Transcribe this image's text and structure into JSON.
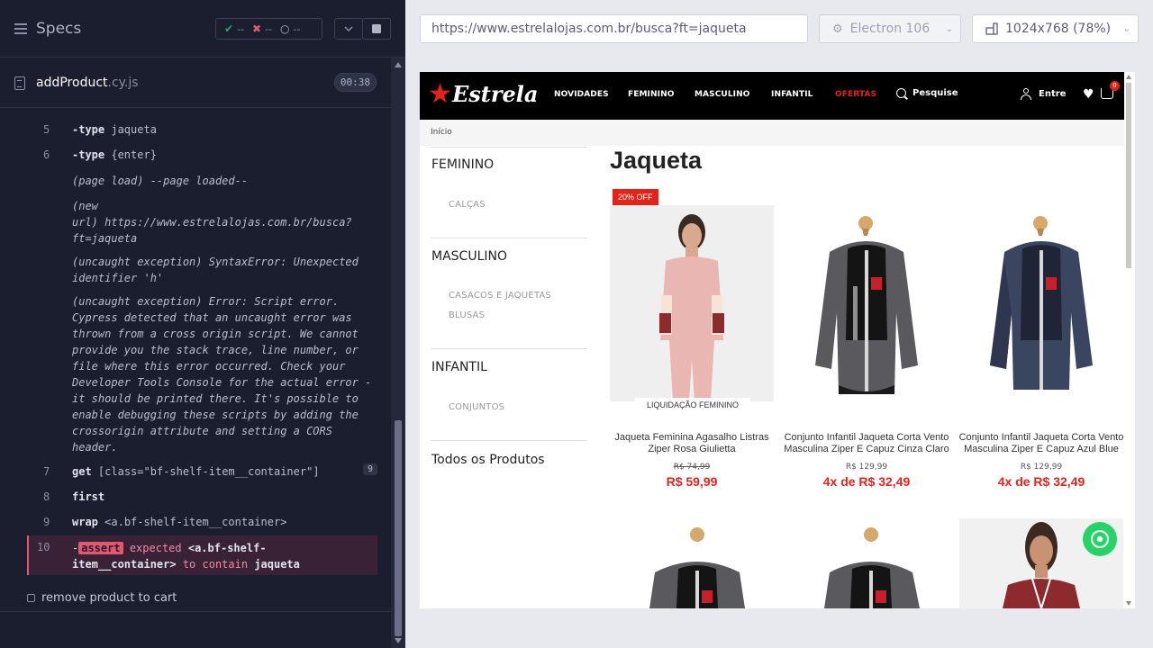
{
  "reporter": {
    "title": "Specs",
    "stats": {
      "passed": "--",
      "failed": "--",
      "pending": "--"
    },
    "spec": {
      "name": "addProduct",
      "ext": ".cy.js",
      "duration": "00:38"
    },
    "commands": [
      {
        "num": "5",
        "name": "-type",
        "arg": "jaqueta"
      },
      {
        "num": "6",
        "name": "-type",
        "arg": "{enter}"
      },
      {
        "num": "7",
        "name": "get",
        "arg": "[class=\"bf-shelf-item__container\"]",
        "count": "9"
      },
      {
        "num": "8",
        "name": "first",
        "arg": ""
      },
      {
        "num": "9",
        "name": "wrap",
        "arg": "<a.bf-shelf-item__container>"
      }
    ],
    "page_load": "(page load)  --page loaded--",
    "new_url_label": "(new",
    "new_url_line": "url)  https://www.estrelalojas.com.br/busca?",
    "new_url_tail": "ft=jaqueta",
    "exc1_l1": "(uncaught exception)  SyntaxError: Unexpected",
    "exc1_l2": "identifier 'h'",
    "exc2_lines": [
      "(uncaught exception)  Error: Script error.",
      "Cypress detected that an uncaught error was",
      "thrown from a cross origin script. We cannot",
      "provide you the stack trace, line number, or",
      "file where this error occurred. Check your",
      "Developer Tools Console for the actual error -",
      "it should be printed there. It's possible to",
      "enable debugging these scripts by adding the",
      "crossorigin attribute and setting a CORS",
      "header."
    ],
    "assert": {
      "num": "10",
      "dash": "-",
      "badge": "assert",
      "expected": "expected",
      "subject1": "<a.bf-shelf-",
      "subject2": "item__container>",
      "to_contain": "to contain",
      "value": "jaqueta"
    },
    "next_test": "remove product to cart"
  },
  "browser": {
    "url": "https://www.estrelalojas.com.br/busca?ft=jaqueta",
    "engine": "Electron 106",
    "viewport": "1024x768  (78%)"
  },
  "site": {
    "logo": "Estrela",
    "nav": [
      "NOVIDADES",
      "FEMININO",
      "MASCULINO",
      "INFANTIL",
      "OFERTAS"
    ],
    "search": "Pesquise",
    "login": "Entre",
    "cart_count": "0",
    "breadcrumb": "Início",
    "sidebar": {
      "feminino": "FEMININO",
      "calcas": "CALÇAS",
      "masculino": "MASCULINO",
      "casacos": "CASACOS E JAQUETAS",
      "blusas": "BLUSAS",
      "infantil": "INFANTIL",
      "conjuntos": "CONJUNTOS",
      "todos": "Todos os Produtos"
    },
    "page_title": "Jaqueta",
    "products": [
      {
        "badge": "20% OFF",
        "tag": "LIQUIDAÇÃO FEMININO",
        "name": "Jaqueta Feminina Agasalho Listras Ziper Rosa Giulietta",
        "old_price": "R$ 74,99",
        "price": "R$ 59,99"
      },
      {
        "name": "Conjunto Infantil Jaqueta Corta Vento Masculina Ziper E Capuz Cinza Claro",
        "old_price": "R$ 129,99",
        "price": "4x de R$ 32,49"
      },
      {
        "name": "Conjunto Infantil Jaqueta Corta Vento Masculina Ziper E Capuz Azul Blue",
        "old_price": "R$ 129,99",
        "price": "4x de R$ 32,49"
      }
    ],
    "colors": {
      "brand_red": "#e2231a",
      "whatsapp": "#25d366"
    }
  }
}
